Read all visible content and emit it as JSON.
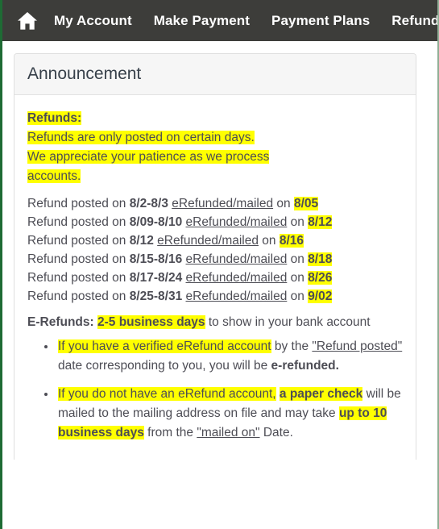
{
  "navbar": {
    "home_icon": "home-icon",
    "items": [
      {
        "label": "My Account"
      },
      {
        "label": "Make Payment"
      },
      {
        "label": "Payment Plans"
      },
      {
        "label": "Refunds"
      }
    ]
  },
  "card": {
    "title": "Announcement",
    "intro": {
      "heading": "Refunds:",
      "line1": "Refunds are only posted on certain days.",
      "line2": "We appreciate your patience as we process",
      "line3": "accounts."
    },
    "refund_rows": {
      "prefix": "Refund posted on",
      "link_label": "eRefunded/mailed",
      "mid": "on",
      "rows": [
        {
          "posted": "8/2-8/3",
          "mailed": "8/05"
        },
        {
          "posted": "8/09-8/10",
          "mailed": "8/12"
        },
        {
          "posted": "8/12",
          "mailed": "8/16"
        },
        {
          "posted": "8/15-8/16",
          "mailed": "8/18"
        },
        {
          "posted": "8/17-8/24",
          "mailed": "8/26"
        },
        {
          "posted": "8/25-8/31",
          "mailed": "9/02"
        }
      ]
    },
    "erefunds": {
      "label": "E-Refunds:",
      "duration": "2-5 business days",
      "tail": "to show in your bank account"
    },
    "notes": [
      {
        "part1": "If you have a verified eRefund account",
        "part2": "by the",
        "part3": "\"Refund posted\"",
        "part4": "date corresponding to you, you will be",
        "part5": "e-refunded."
      },
      {
        "part1": "If you do not have an eRefund account,",
        "part2": "a paper check",
        "part3": "will be mailed to the mailing address on file and may take",
        "part4": "up to 10 business days",
        "part5": "from the",
        "part6": "\"mailed on\"",
        "part7": "Date."
      }
    ]
  },
  "colors": {
    "navbar_bg": "#3d3d3a",
    "highlight": "#ffff00",
    "accent_border": "#1e6b34",
    "body_text": "#4d4d55"
  }
}
